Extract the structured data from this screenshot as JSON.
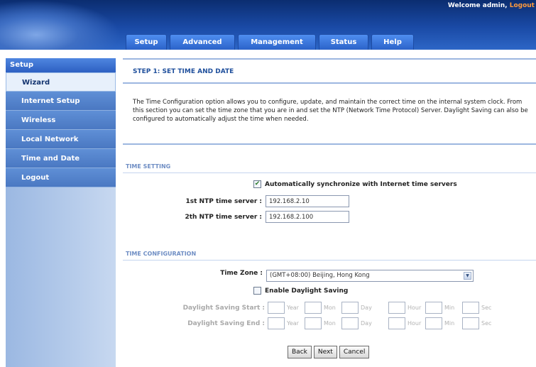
{
  "header": {
    "welcome": "Welcome admin,",
    "logout": "Logout"
  },
  "tabs": [
    "Setup",
    "Advanced",
    "Management",
    "Status",
    "Help"
  ],
  "sidebar": {
    "title": "Setup",
    "items": [
      "Wizard",
      "Internet Setup",
      "Wireless",
      "Local Network",
      "Time and Date",
      "Logout"
    ]
  },
  "page": {
    "step_title": "STEP 1: SET TIME AND DATE",
    "intro": "The Time Configuration option allows you to configure, update, and maintain the correct time on the internal system clock. From this section you can set the time zone that you are in and set the NTP (Network Time Protocol) Server. Daylight Saving can also be configured to automatically adjust the time when needed."
  },
  "time_setting": {
    "title": "TIME SETTING",
    "auto_sync_label": "Automatically synchronize with Internet time servers",
    "auto_sync_checked": true,
    "ntp1_label": "1st NTP time server :",
    "ntp1_value": "192.168.2.10",
    "ntp2_label": "2th NTP time server :",
    "ntp2_value": "192.168.2.100"
  },
  "time_config": {
    "title": "TIME CONFIGURATION",
    "timezone_label": "Time Zone :",
    "timezone_value": "(GMT+08:00) Beijing, Hong Kong",
    "dst_label": "Enable Daylight Saving",
    "dst_checked": false,
    "dst_start_label": "Daylight Saving Start :",
    "dst_end_label": "Daylight Saving End :",
    "units": [
      "Year",
      "Mon",
      "Day",
      "Hour",
      "Min",
      "Sec"
    ]
  },
  "buttons": {
    "back": "Back",
    "next": "Next",
    "cancel": "Cancel"
  }
}
